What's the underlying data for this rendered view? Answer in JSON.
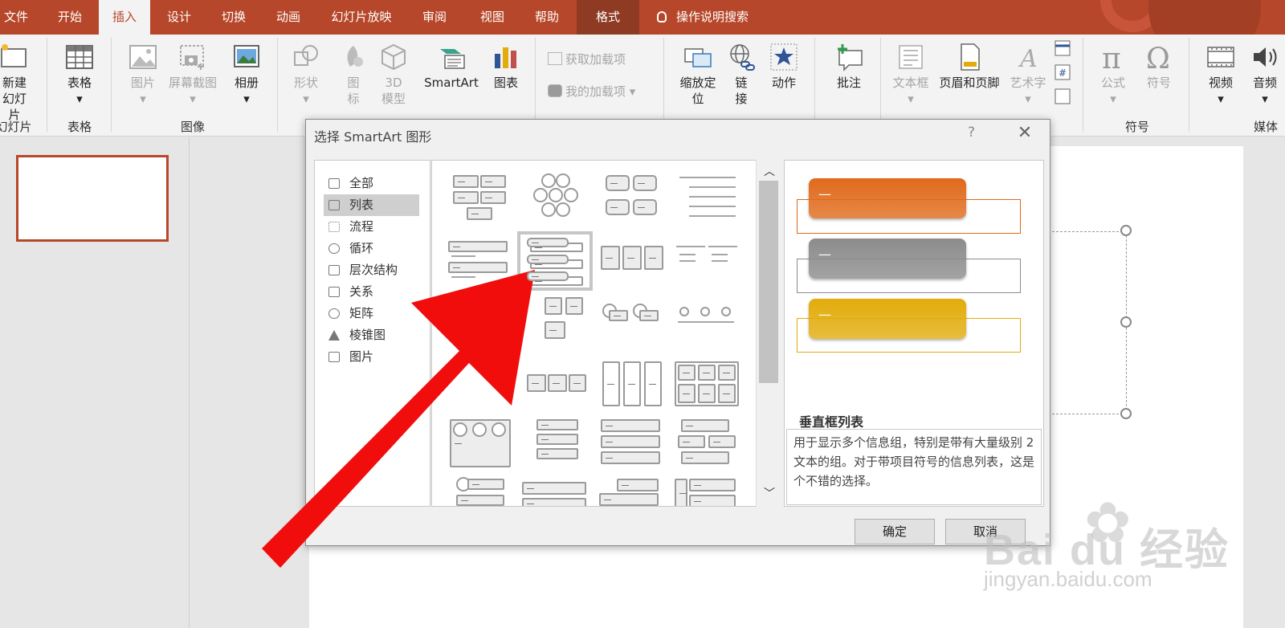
{
  "ribbon": {
    "tabs": [
      {
        "label": "文件"
      },
      {
        "label": "开始"
      },
      {
        "label": "插入"
      },
      {
        "label": "设计"
      },
      {
        "label": "切换"
      },
      {
        "label": "动画"
      },
      {
        "label": "幻灯片放映"
      },
      {
        "label": "审阅"
      },
      {
        "label": "视图"
      },
      {
        "label": "帮助"
      },
      {
        "label": "格式"
      }
    ],
    "active_tab": "插入",
    "tell_me": "操作说明搜索",
    "buttons": {
      "new_slide_1": "新建",
      "new_slide_2": "幻灯片",
      "table": "表格",
      "picture": "图片",
      "screenshot": "屏幕截图",
      "album": "相册",
      "shapes": "形状",
      "icons_1": "图",
      "icons_2": "标",
      "model_1": "3D",
      "model_2": "模型",
      "smartart": "SmartArt",
      "chart": "图表",
      "get_addins": "获取加载项",
      "my_addins": "我的加载项",
      "zoom_1": "缩放定",
      "zoom_2": "位",
      "link_1": "链",
      "link_2": "接",
      "action": "动作",
      "comment": "批注",
      "textbox": "文本框",
      "header_footer": "页眉和页脚",
      "wordart": "艺术字",
      "equation": "公式",
      "symbol": "符号",
      "video": "视频",
      "audio": "音频"
    },
    "groups": {
      "slides": "幻灯片",
      "tables": "表格",
      "images": "图像",
      "symbols": "符号",
      "media": "媒体"
    }
  },
  "dialog": {
    "title": "选择 SmartArt 图形",
    "help": "?",
    "close": "✕",
    "categories": [
      {
        "label": "全部"
      },
      {
        "label": "列表"
      },
      {
        "label": "流程"
      },
      {
        "label": "循环"
      },
      {
        "label": "层次结构"
      },
      {
        "label": "关系"
      },
      {
        "label": "矩阵"
      },
      {
        "label": "棱锥图"
      },
      {
        "label": "图片"
      }
    ],
    "selected_category": "列表",
    "preview": {
      "placeholder": "—",
      "colors": [
        "#e06a1b",
        "#8c8c8c",
        "#e2ac0c"
      ],
      "name": "垂直框列表",
      "description": "用于显示多个信息组，特别是带有大量级别 2 文本的组。对于带项目符号的信息列表，这是个不错的选择。"
    },
    "ok": "确定",
    "cancel": "取消"
  },
  "watermark": {
    "logo": "Bai du 经验",
    "url": "jingyan.baidu.com"
  },
  "annotation_arrow_color": "#f20d0d"
}
